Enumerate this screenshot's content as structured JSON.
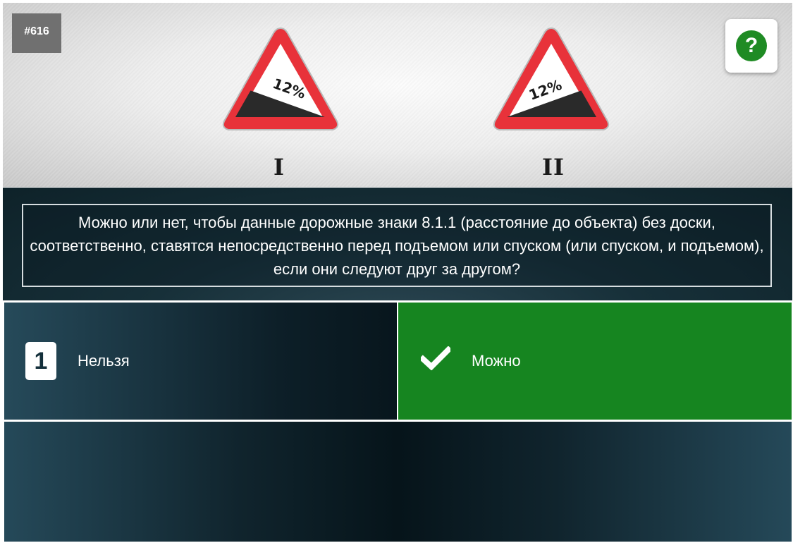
{
  "question_number": "#616",
  "help": {
    "icon": "question-icon",
    "label": "?"
  },
  "image": {
    "signs": [
      {
        "label": "I",
        "text": "12%",
        "icon": "steep-descent-sign"
      },
      {
        "label": "II",
        "text": "12%",
        "icon": "steep-ascent-sign"
      }
    ]
  },
  "question": {
    "text": "Можно или нет, чтобы данные дорожные знаки 8.1.1 (расстояние до объекта) без доски, соответственно, ставятся непосредственно перед подъемом или спуском (или спуском, и подъемом), если они следуют друг за другом?"
  },
  "answers": [
    {
      "number": "1",
      "text": "Нельзя",
      "state": "default"
    },
    {
      "icon": "checkmark-icon",
      "text": "Можно",
      "state": "correct"
    }
  ],
  "colors": {
    "correct": "#168520",
    "help_green": "#1f8b24",
    "sign_red": "#e8323a",
    "dark_panel": "#0e2229"
  }
}
